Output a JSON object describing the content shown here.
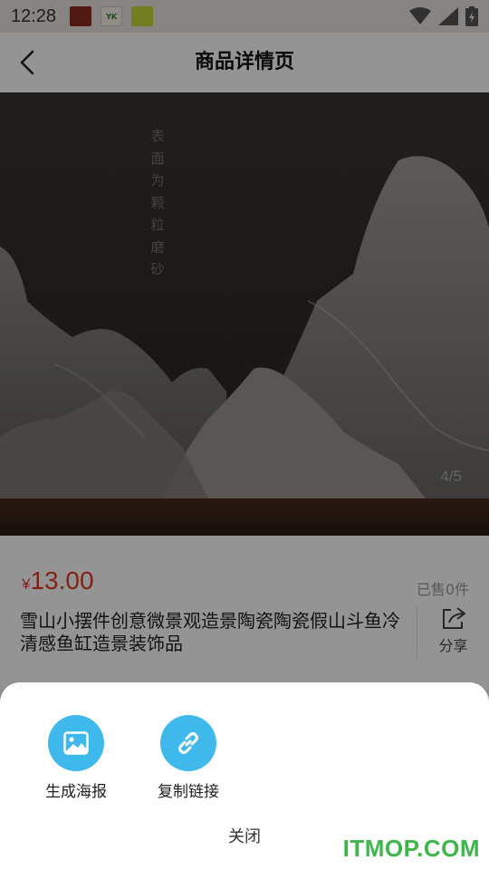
{
  "status_bar": {
    "time": "12:28",
    "notification_icons": [
      "app-icon-1",
      "app-icon-yk",
      "app-icon-3"
    ],
    "system_icons": [
      "wifi-icon",
      "signal-icon",
      "battery-icon"
    ]
  },
  "nav": {
    "title": "商品详情页",
    "back_icon": "chevron-left-icon"
  },
  "hero": {
    "vertical_text": "表面为颗粒磨砂",
    "counter": "4/5"
  },
  "product": {
    "currency": "¥",
    "price": "13.00",
    "sold": "已售0件",
    "title": "雪山小摆件创意微景观造景陶瓷陶瓷假山斗鱼冷清感鱼缸造景装饰品",
    "share_label": "分享"
  },
  "sheet": {
    "actions": [
      {
        "label": "生成海报",
        "icon": "image-icon"
      },
      {
        "label": "复制链接",
        "icon": "link-icon"
      }
    ],
    "close_label": "关闭"
  },
  "watermark": "ITMOP.COM",
  "colors": {
    "accent": "#3fb9ec",
    "price": "#e03a2a",
    "watermark": "#3db64a"
  }
}
